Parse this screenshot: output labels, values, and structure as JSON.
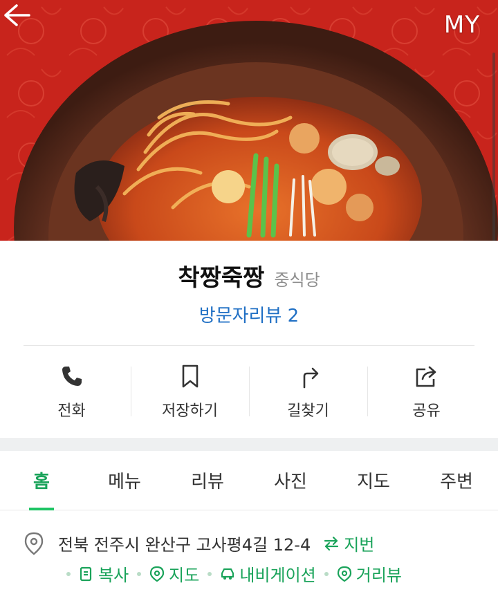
{
  "header": {
    "back_icon": "arrow-left-icon",
    "my_label": "MY"
  },
  "place": {
    "name": "착짱죽짱",
    "category": "중식당",
    "visitor_review": "방문자리뷰 2"
  },
  "actions": [
    {
      "label": "전화",
      "icon": "phone-icon"
    },
    {
      "label": "저장하기",
      "icon": "bookmark-icon"
    },
    {
      "label": "길찾기",
      "icon": "directions-icon"
    },
    {
      "label": "공유",
      "icon": "share-icon"
    }
  ],
  "tabs": [
    {
      "label": "홈",
      "active": true
    },
    {
      "label": "메뉴"
    },
    {
      "label": "리뷰"
    },
    {
      "label": "사진"
    },
    {
      "label": "지도"
    },
    {
      "label": "주변"
    }
  ],
  "address": {
    "text": "전북 전주시 완산구 고사평4길 12-4",
    "jibun_label": "지번",
    "links": [
      {
        "label": "복사",
        "icon": "copy-icon"
      },
      {
        "label": "지도",
        "icon": "map-pin-icon"
      },
      {
        "label": "내비게이션",
        "icon": "car-icon"
      },
      {
        "label": "거리뷰",
        "icon": "street-view-icon"
      }
    ]
  },
  "colors": {
    "accent_green": "#1aa35a",
    "link_blue": "#1f6fc4",
    "hero_background": "#c8241c"
  }
}
